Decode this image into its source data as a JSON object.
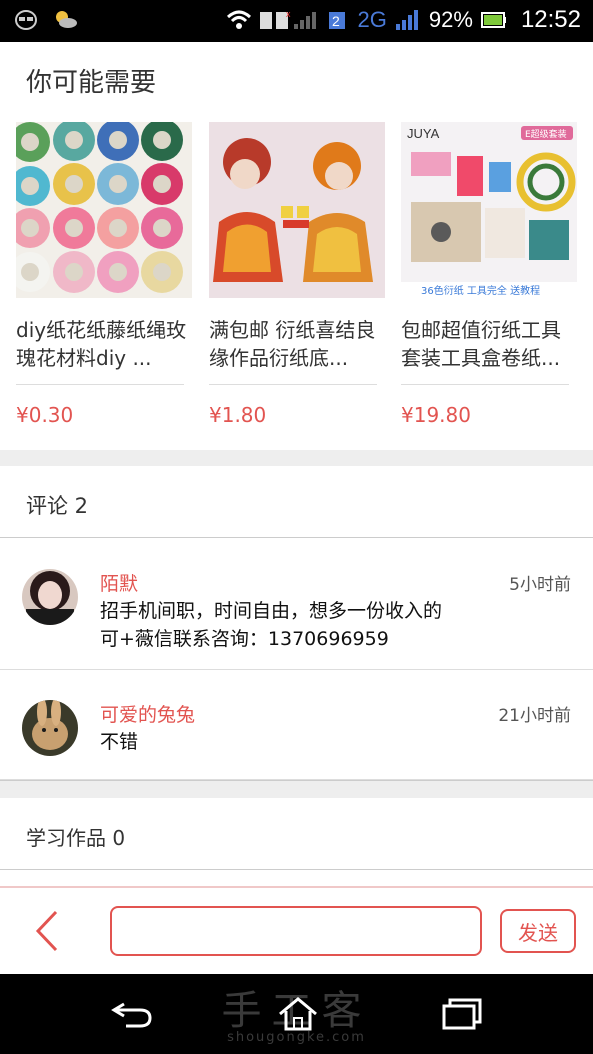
{
  "status_bar": {
    "battery": "92%",
    "time": "12:52",
    "network": "2G"
  },
  "recommendations": {
    "title": "你可能需要",
    "items": [
      {
        "name": "diy纸花纸藤纸绳玫瑰花材料diy ...",
        "price": "¥0.30"
      },
      {
        "name": "满包邮 衍纸喜结良缘作品衍纸底...",
        "price": "¥1.80"
      },
      {
        "name": "包邮超值衍纸工具套装工具盒卷纸...",
        "price": "¥19.80"
      }
    ],
    "image3_text": {
      "brand": "JUYA",
      "badge": "E超级套装",
      "footer": "36色衍纸 工具完全 送教程"
    }
  },
  "comments": {
    "title": "评论 2",
    "items": [
      {
        "user": "陌默",
        "time": "5小时前",
        "text_line1": "招手机间职，时间自由，想多一份收入的",
        "text_line2": "可+薇信联系咨询：1370696959"
      },
      {
        "user": "可爱的兔兔",
        "time": "21小时前",
        "text_line1": "不错"
      }
    ]
  },
  "works": {
    "title": "学习作品 0"
  },
  "input_bar": {
    "placeholder": "",
    "send_label": "发送"
  },
  "watermark": {
    "cn": "手工客",
    "en": "shougongke.com"
  },
  "colors": {
    "accent": "#e25450",
    "divider_bg": "#eeeeee"
  }
}
